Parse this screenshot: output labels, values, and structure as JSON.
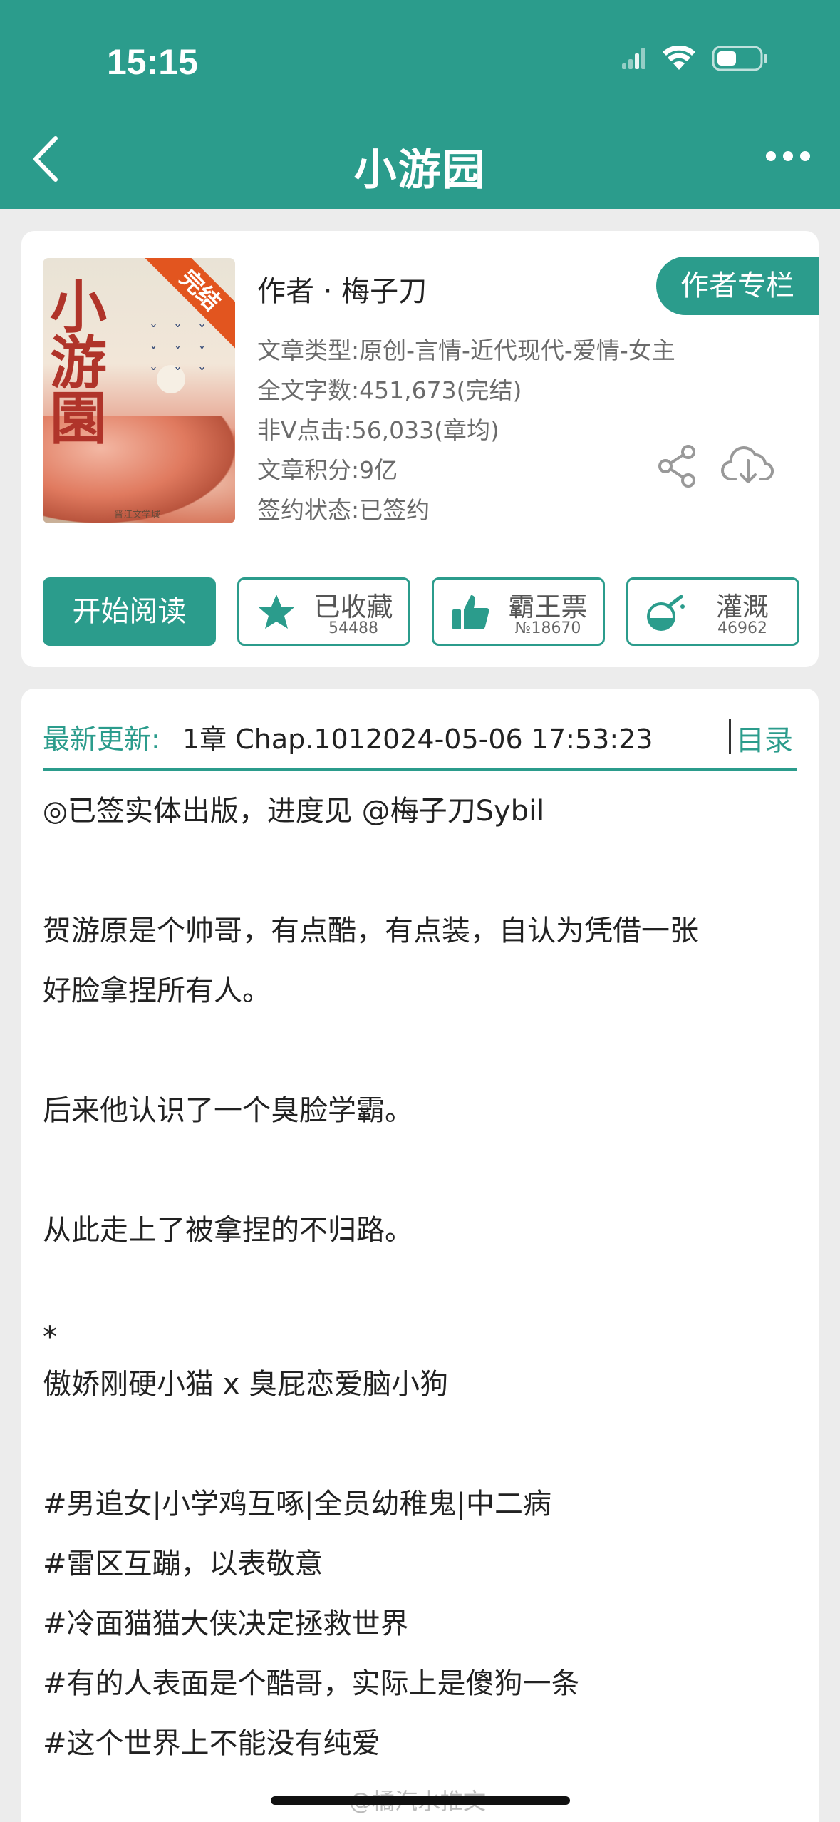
{
  "status": {
    "time": "15:15"
  },
  "nav": {
    "title": "小游园"
  },
  "book": {
    "cover_title": "小游園",
    "cover_ribbon": "完结",
    "cover_publisher": "晋江文学城",
    "author": "作者 · 梅子刀",
    "author_column_label": "作者专栏",
    "meta": [
      "文章类型:原创-言情-近代现代-爱情-女主",
      "全文字数:451,673(完结)",
      "非V点击:56,033(章均)",
      "文章积分:9亿",
      "签约状态:已签约"
    ],
    "actions": {
      "read_label": "开始阅读",
      "favorite": {
        "label": "已收藏",
        "count": "54488"
      },
      "vote": {
        "label": "霸王票",
        "count": "№18670"
      },
      "water": {
        "label": "灌溉",
        "count": "46962"
      }
    }
  },
  "update": {
    "label": "最新更新:",
    "value": "1章 Chap.1012024-05-06 17:53:23",
    "toc_label": "目录"
  },
  "intro": [
    "◎已签实体出版，进度见 @梅子刀Sybil",
    "",
    "贺游原是个帅哥，有点酷，有点装，自认为凭借一张",
    "好脸拿捏所有人。",
    "",
    "后来他认识了一个臭脸学霸。",
    "",
    "从此走上了被拿捏的不归路。",
    "",
    "*",
    "傲娇刚硬小猫 x 臭屁恋爱脑小狗",
    "",
    "#男追女|小学鸡互啄|全员幼稚鬼|中二病",
    "#雷区互蹦，以表敬意",
    "#冷面猫猫大侠决定拯救世界",
    "#有的人表面是个酷哥，实际上是傻狗一条",
    "#这个世界上不能没有纯爱"
  ],
  "watermark": "@橘汽水推文",
  "colors": {
    "accent": "#2b9c8c"
  }
}
